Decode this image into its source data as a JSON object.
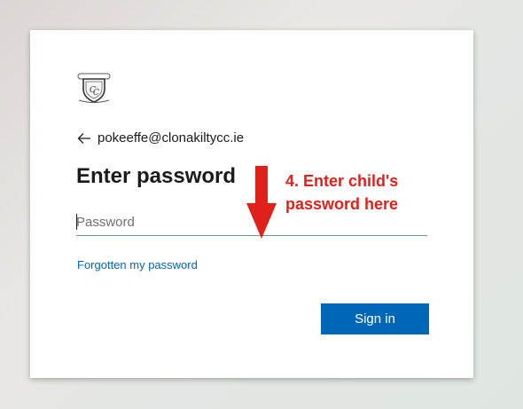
{
  "login": {
    "logo_icon": "school-crest-icon",
    "back_icon": "arrow-left-icon",
    "account_email": "pokeeffe@clonakiltycc.ie",
    "title": "Enter password",
    "password_placeholder": "Password",
    "password_value": "",
    "forgot_link": "Forgotten my password",
    "signin_label": "Sign in"
  },
  "annotation": {
    "arrow_icon": "red-down-arrow-icon",
    "line1": "4. Enter child's",
    "line2": "password here",
    "color": "#e0201b"
  },
  "colors": {
    "accent": "#0067b8",
    "text": "#1b1b1b"
  }
}
